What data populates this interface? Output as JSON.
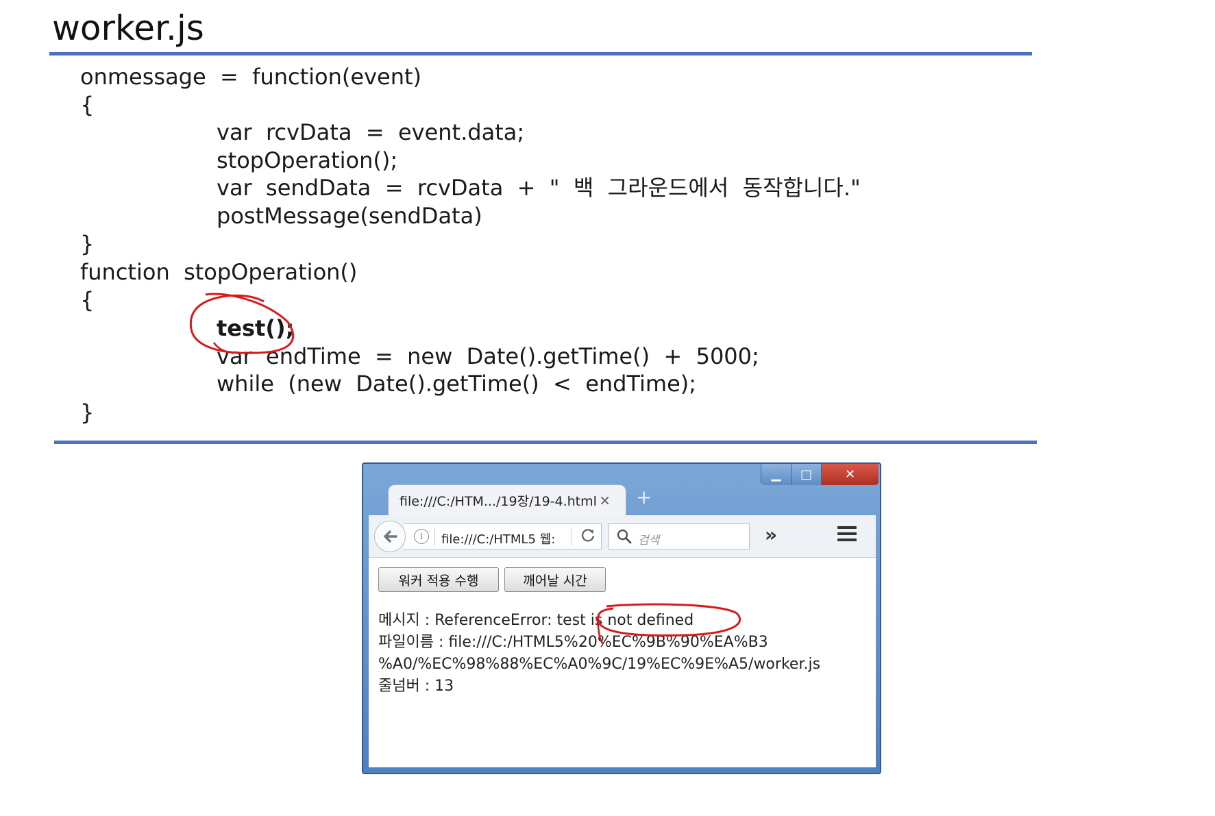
{
  "slide": {
    "title": "worker.js"
  },
  "code": {
    "lines": [
      "onmessage  =  function(event)",
      "{",
      "var  rcvData  =  event.data;",
      "stopOperation();",
      "var  sendData  =  rcvData  +  \"  백  그라운드에서  동작합니다.\"",
      "postMessage(sendData)",
      "}",
      "function  stopOperation()",
      "{",
      "test();",
      "var  endTime  =  new  Date().getTime()  +  5000;",
      "while  (new  Date().getTime()  <  endTime);",
      "}"
    ]
  },
  "browser": {
    "tab_title": "file:///C:/HTM.../19장/19-4.html",
    "tab_close": "×",
    "new_tab": "+",
    "url": "file:///C:/HTML5 웹:",
    "search_placeholder": "검색",
    "overflow": "»",
    "win_min": "▁",
    "win_max": "□",
    "win_close": "✕",
    "buttons": {
      "run_worker": "워커 적용 수행",
      "wake_time": "깨어날 시간"
    },
    "output": {
      "line1": "메시지 : ReferenceError: test is not defined",
      "line2": "파일이름 : file:///C:/HTML5%20%EC%9B%90%EA%B3",
      "line3": "%A0/%EC%98%88%EC%A0%9C/19%EC%9E%A5/worker.js",
      "line4": "줄넘버 : 13"
    }
  },
  "colors": {
    "rule": "#4a72c0",
    "annotation": "#d81a1a"
  },
  "icons": [
    "back-arrow-icon",
    "info-icon",
    "reload-icon",
    "search-icon",
    "overflow-icon",
    "hamburger-menu-icon",
    "tab-close-icon",
    "new-tab-icon",
    "minimize-icon",
    "maximize-icon",
    "window-close-icon"
  ]
}
